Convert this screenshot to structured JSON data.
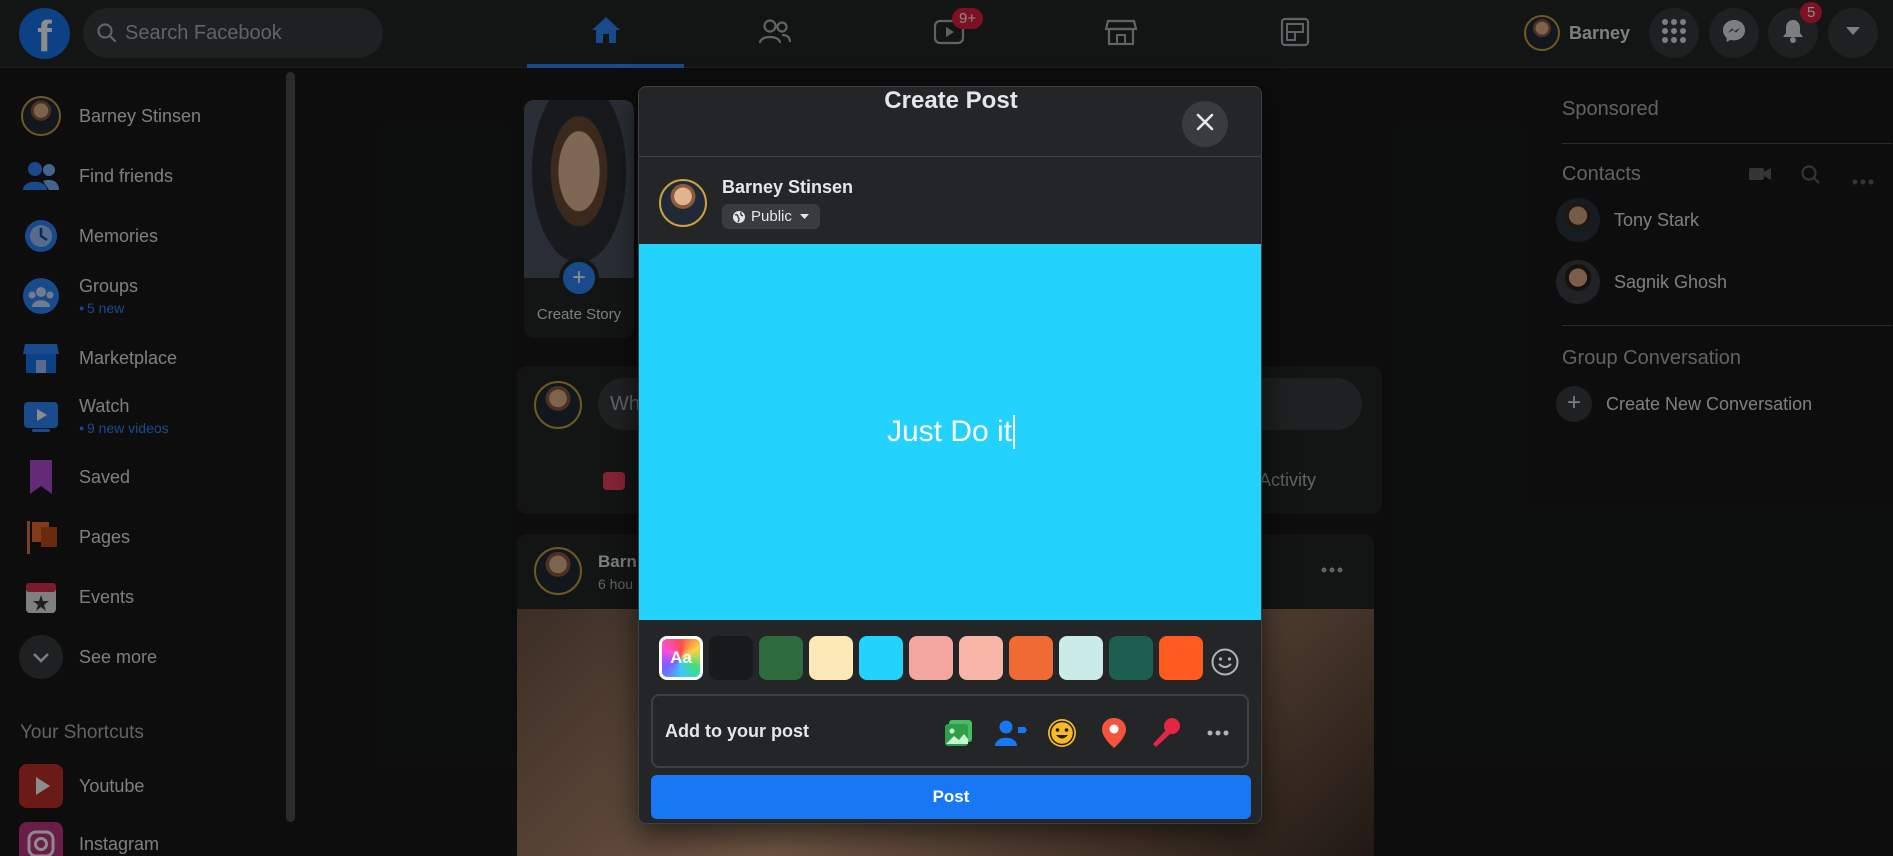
{
  "topbar": {
    "logo": "f",
    "search_placeholder": "Search Facebook",
    "watch_badge": "9+",
    "profile_name": "Barney",
    "notifications_badge": "5"
  },
  "sidebar": {
    "items": [
      {
        "label": "Barney Stinsen",
        "icon": "avatar",
        "sub": ""
      },
      {
        "label": "Find friends",
        "icon": "friends-icon",
        "sub": ""
      },
      {
        "label": "Memories",
        "icon": "clock-icon",
        "sub": ""
      },
      {
        "label": "Groups",
        "icon": "groups-icon",
        "sub": "5 new"
      },
      {
        "label": "Marketplace",
        "icon": "store-icon",
        "sub": ""
      },
      {
        "label": "Watch",
        "icon": "play-icon",
        "sub": "9 new videos"
      },
      {
        "label": "Saved",
        "icon": "bookmark-icon",
        "sub": ""
      },
      {
        "label": "Pages",
        "icon": "flag-icon",
        "sub": ""
      },
      {
        "label": "Events",
        "icon": "calendar-icon",
        "sub": ""
      },
      {
        "label": "See more",
        "icon": "chevron-down-icon",
        "sub": ""
      }
    ],
    "shortcuts_title": "Your Shortcuts",
    "shortcuts": [
      {
        "label": "Youtube",
        "icon": "youtube-icon"
      },
      {
        "label": "Instagram",
        "icon": "instagram-icon"
      }
    ]
  },
  "feed": {
    "create_story": "Create Story",
    "composer_placeholder": "Wh",
    "activity_label": "Activity",
    "post_author": "Barn",
    "post_time": "6 hou"
  },
  "rightbar": {
    "sponsored": "Sponsored",
    "contacts_title": "Contacts",
    "contacts": [
      "Tony Stark",
      "Sagnik Ghosh"
    ],
    "group_title": "Group Conversation",
    "create_conversation": "Create New Conversation"
  },
  "modal": {
    "title": "Create Post",
    "user_name": "Barney Stinsen",
    "privacy": "Public",
    "post_text": "Just Do it",
    "canvas_color": "#24d2fe",
    "swatch_aa": "Aa",
    "swatch_colors": [
      "#18191a",
      "#2e6b3f",
      "#fde8b8",
      "#24d2fe",
      "#f4a6a0",
      "#f7b6a8",
      "#f06a34",
      "#c9ece9",
      "#1c5e4f",
      "#ff5a1f"
    ],
    "add_to_post": "Add to your post",
    "post_button": "Post"
  },
  "colors": {
    "accent": "#1877f2",
    "badge": "#e41e3f",
    "background": "#18191a",
    "surface": "#242526"
  }
}
